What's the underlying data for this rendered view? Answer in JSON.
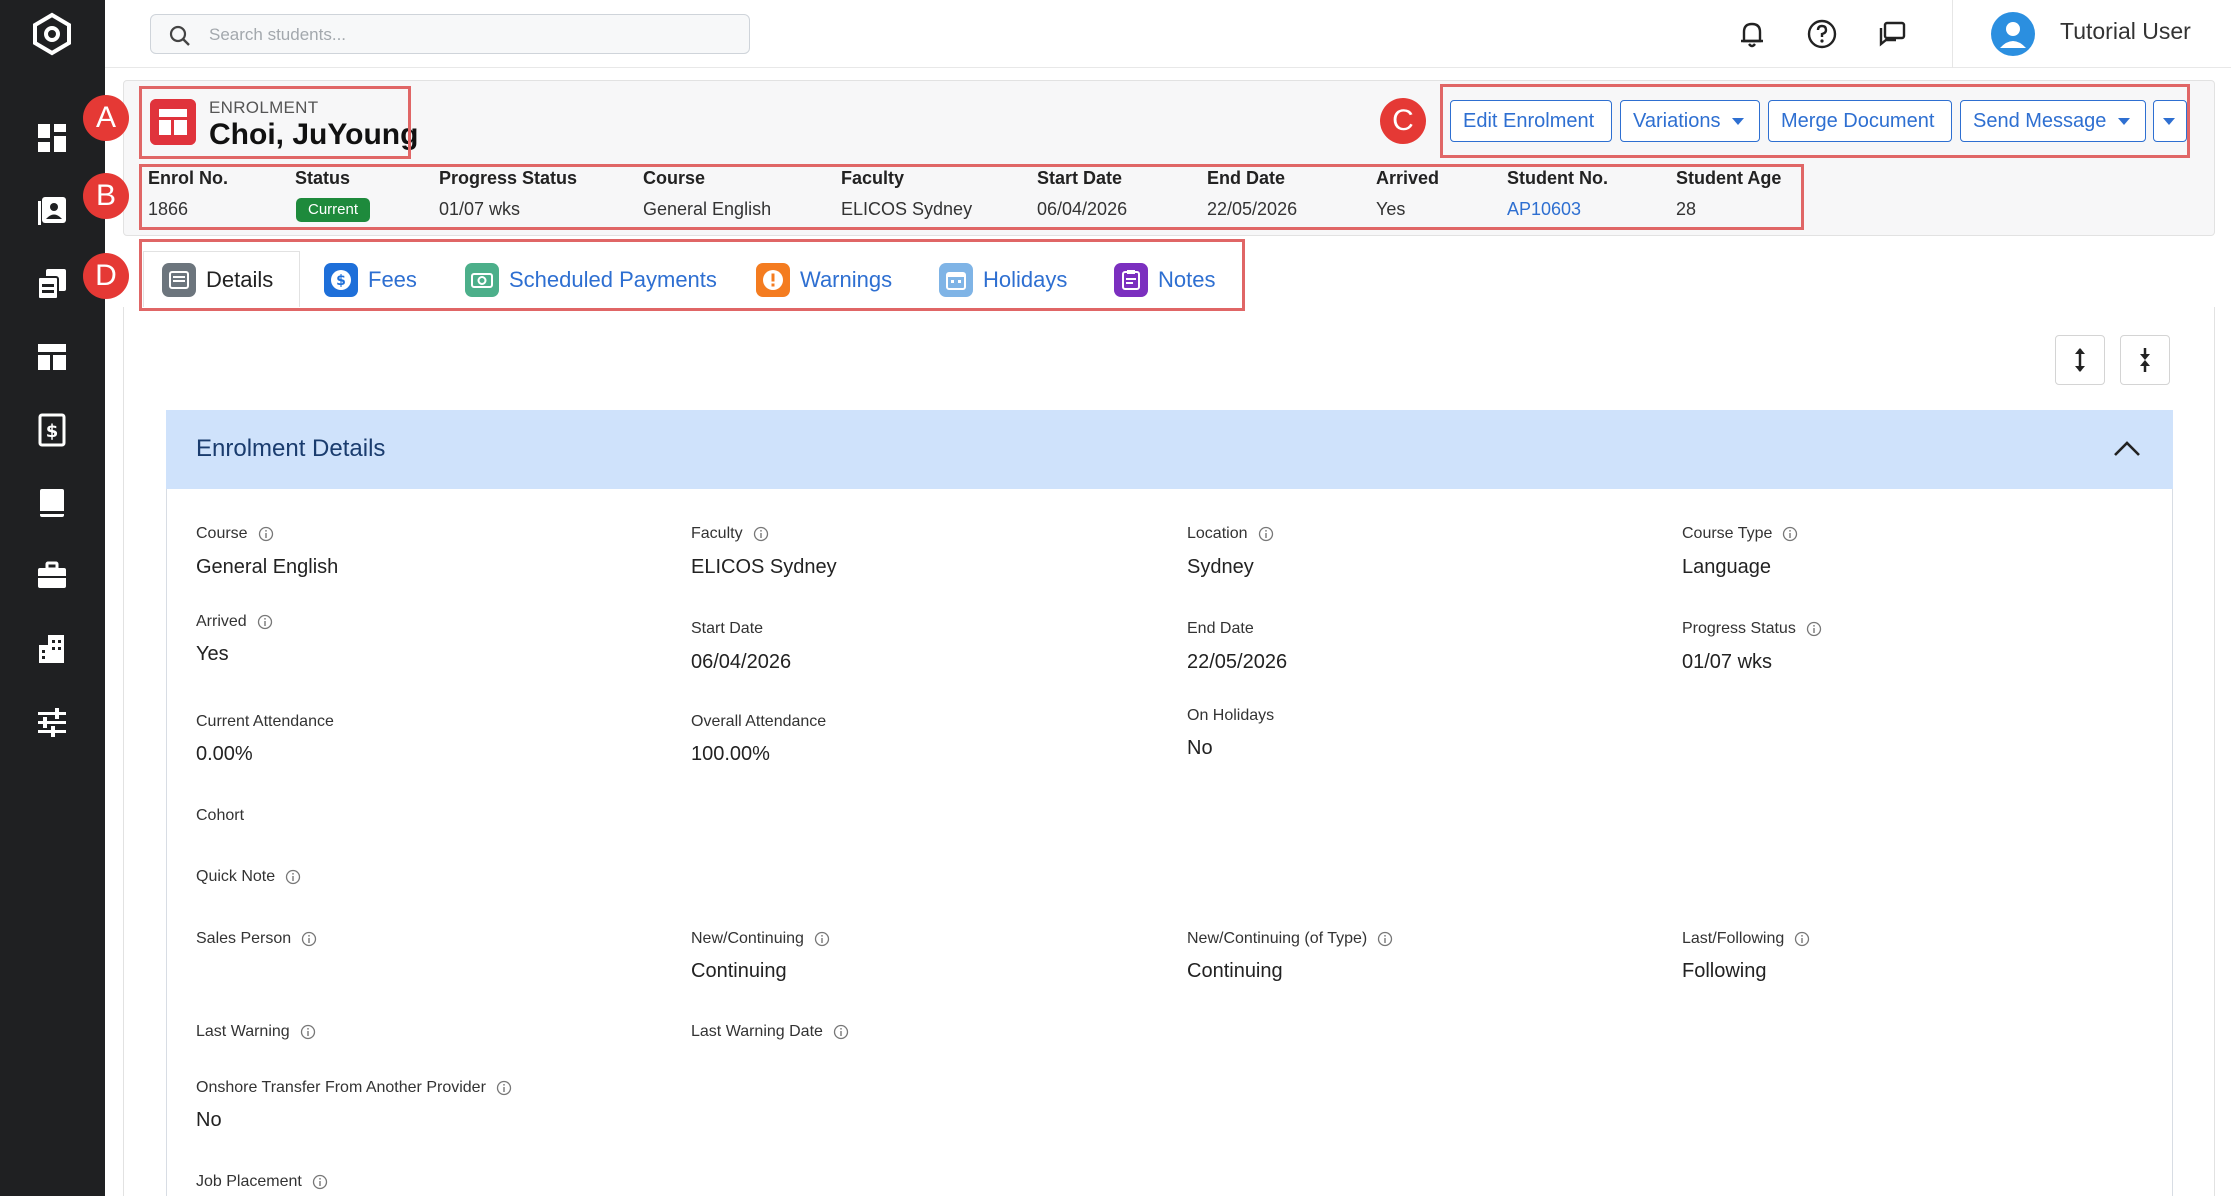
{
  "search": {
    "placeholder": "Search students..."
  },
  "user": {
    "name": "Tutorial User"
  },
  "annotations": {
    "a": "A",
    "b": "B",
    "c": "C",
    "d": "D"
  },
  "header": {
    "type_label": "ENROLMENT",
    "student_name": "Choi, JuYoung",
    "buttons": {
      "edit": "Edit Enrolment",
      "variations": "Variations",
      "merge": "Merge Document",
      "send": "Send Message"
    }
  },
  "summary": {
    "headers": [
      "Enrol No.",
      "Status",
      "Progress Status",
      "Course",
      "Faculty",
      "Start Date",
      "End Date",
      "Arrived",
      "Student No.",
      "Student Age"
    ],
    "enrol_no": "1866",
    "status": "Current",
    "progress": "01/07 wks",
    "course": "General English",
    "faculty": "ELICOS Sydney",
    "start": "06/04/2026",
    "end": "22/05/2026",
    "arrived": "Yes",
    "student_no": "AP10603",
    "age": "28"
  },
  "tabs": [
    "Details",
    "Fees",
    "Scheduled Payments",
    "Warnings",
    "Holidays",
    "Notes"
  ],
  "details": {
    "title": "Enrolment Details",
    "fields": {
      "course": {
        "label": "Course",
        "value": "General English"
      },
      "faculty": {
        "label": "Faculty",
        "value": "ELICOS Sydney"
      },
      "location": {
        "label": "Location",
        "value": "Sydney"
      },
      "course_type": {
        "label": "Course Type",
        "value": "Language"
      },
      "arrived": {
        "label": "Arrived",
        "value": "Yes"
      },
      "start_date": {
        "label": "Start Date",
        "value": "06/04/2026"
      },
      "end_date": {
        "label": "End Date",
        "value": "22/05/2026"
      },
      "progress_status": {
        "label": "Progress Status",
        "value": "01/07 wks"
      },
      "current_attendance": {
        "label": "Current Attendance",
        "value": "0.00%"
      },
      "overall_attendance": {
        "label": "Overall Attendance",
        "value": "100.00%"
      },
      "on_holidays": {
        "label": "On Holidays",
        "value": "No"
      },
      "cohort": {
        "label": "Cohort",
        "value": ""
      },
      "quick_note": {
        "label": "Quick Note",
        "value": ""
      },
      "sales_person": {
        "label": "Sales Person",
        "value": ""
      },
      "new_continuing": {
        "label": "New/Continuing",
        "value": "Continuing"
      },
      "new_continuing_type": {
        "label": "New/Continuing (of Type)",
        "value": "Continuing"
      },
      "last_following": {
        "label": "Last/Following",
        "value": "Following"
      },
      "last_warning": {
        "label": "Last Warning",
        "value": ""
      },
      "last_warning_date": {
        "label": "Last Warning Date",
        "value": ""
      },
      "onshore_transfer": {
        "label": "Onshore Transfer From Another Provider",
        "value": "No"
      },
      "job_placement": {
        "label": "Job Placement",
        "value": ""
      }
    }
  },
  "colors": {
    "sidebar": "#1f2022",
    "accent": "#2e6fd1",
    "status_green": "#1e8a3c",
    "annotation": "#e53935",
    "details_head": "#cfe2fb"
  }
}
